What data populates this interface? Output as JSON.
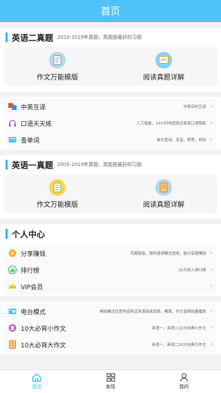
{
  "header": {
    "title": "首页"
  },
  "section_en2": {
    "title": "英语二真题",
    "subtitle": "2010-2019年真题，真题是最好的习题",
    "cards": [
      {
        "label": "作文万能模版",
        "icon": "document-icon"
      },
      {
        "label": "阅读真题详解",
        "icon": "reading-icon"
      }
    ]
  },
  "tools": [
    {
      "label": "中英互译",
      "desc": "中英实时互译",
      "icon": "translate-icon"
    },
    {
      "label": "口语天天练",
      "desc": "人工智能，24小时地道英式英语口语陪练",
      "icon": "headphones-icon"
    },
    {
      "label": "查单词",
      "desc": "单次查询，发音，意思，例句",
      "icon": "dictionary-icon"
    }
  ],
  "section_en1": {
    "title": "英语一真题",
    "subtitle": "2005-2019年真题，真题是最好的习题",
    "cards": [
      {
        "label": "作文万能模版",
        "icon": "document-icon"
      },
      {
        "label": "阅读真题详解",
        "icon": "reading-icon"
      }
    ]
  },
  "personal": {
    "title": "个人中心",
    "rows": [
      {
        "label": "分享赚钱",
        "desc": "专属链接，独特邀请模式提成，裂分享越赚钱",
        "icon": "coin-icon"
      },
      {
        "label": "排行榜",
        "desc": "10大收入排行榜",
        "icon": "ranking-icon"
      },
      {
        "label": "VIP会员",
        "desc": "",
        "icon": "crown-icon"
      }
    ]
  },
  "extras": [
    {
      "label": "电台模式",
      "desc": "睡前模式住意地道英式英语阅读真题，模版，作文音频批量播放",
      "icon": "radio-icon"
    },
    {
      "label": "10大必背小作文",
      "desc": "英语一，英语二10大经典小作文",
      "icon": "small-essay-icon"
    },
    {
      "label": "10大必背大作文",
      "desc": "英语一，英语二10大经典大作文",
      "icon": "big-essay-icon"
    }
  ],
  "tabbar": [
    {
      "label": "首页",
      "icon": "home-icon",
      "active": true
    },
    {
      "label": "发现",
      "icon": "grid-icon",
      "active": false
    },
    {
      "label": "我的",
      "icon": "user-icon",
      "active": false
    }
  ],
  "colors": {
    "accent": "#29b6f6",
    "header": "#4fc3f7"
  }
}
